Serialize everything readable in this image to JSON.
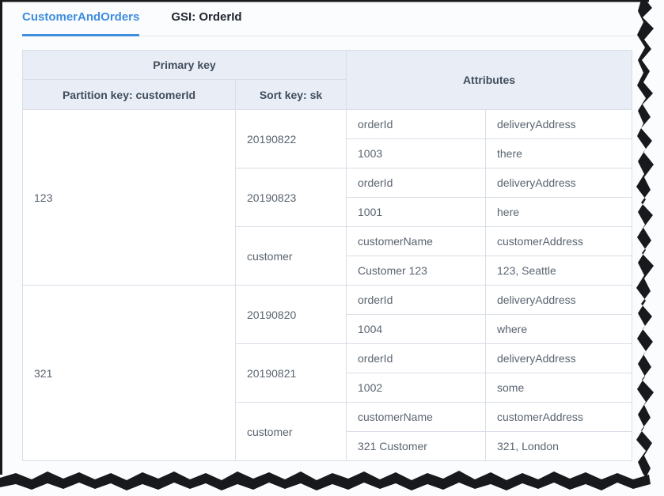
{
  "tabs": [
    {
      "label": "CustomerAndOrders",
      "active": true
    },
    {
      "label": "GSI: OrderId",
      "active": false
    }
  ],
  "table": {
    "header": {
      "primary_key": "Primary key",
      "partition_key": "Partition key: customerId",
      "sort_key": "Sort key: sk",
      "attributes": "Attributes"
    },
    "partitions": [
      {
        "key": "123",
        "blocks": [
          {
            "sort_key": "20190822",
            "attribute_names": [
              "orderId",
              "deliveryAddress"
            ],
            "attribute_values": [
              "1003",
              "there"
            ]
          },
          {
            "sort_key": "20190823",
            "attribute_names": [
              "orderId",
              "deliveryAddress"
            ],
            "attribute_values": [
              "1001",
              "here"
            ]
          },
          {
            "sort_key": "customer",
            "attribute_names": [
              "customerName",
              "customerAddress"
            ],
            "attribute_values": [
              "Customer 123",
              "123, Seattle"
            ]
          }
        ]
      },
      {
        "key": "321",
        "blocks": [
          {
            "sort_key": "20190820",
            "attribute_names": [
              "orderId",
              "deliveryAddress"
            ],
            "attribute_values": [
              "1004",
              "where"
            ]
          },
          {
            "sort_key": "20190821",
            "attribute_names": [
              "orderId",
              "deliveryAddress"
            ],
            "attribute_values": [
              "1002",
              "some"
            ]
          },
          {
            "sort_key": "customer",
            "attribute_names": [
              "customerName",
              "customerAddress"
            ],
            "attribute_values": [
              "321 Customer",
              "321, London"
            ]
          }
        ]
      }
    ]
  },
  "colors": {
    "accent_blue": "#3e8de0",
    "inactive_tab_text": "#21262e",
    "header_background": "#e9eef6",
    "header_text": "#414d5c",
    "cell_text": "#5a6470",
    "table_border": "#d9dee8",
    "torn_edge": "#17191d"
  }
}
